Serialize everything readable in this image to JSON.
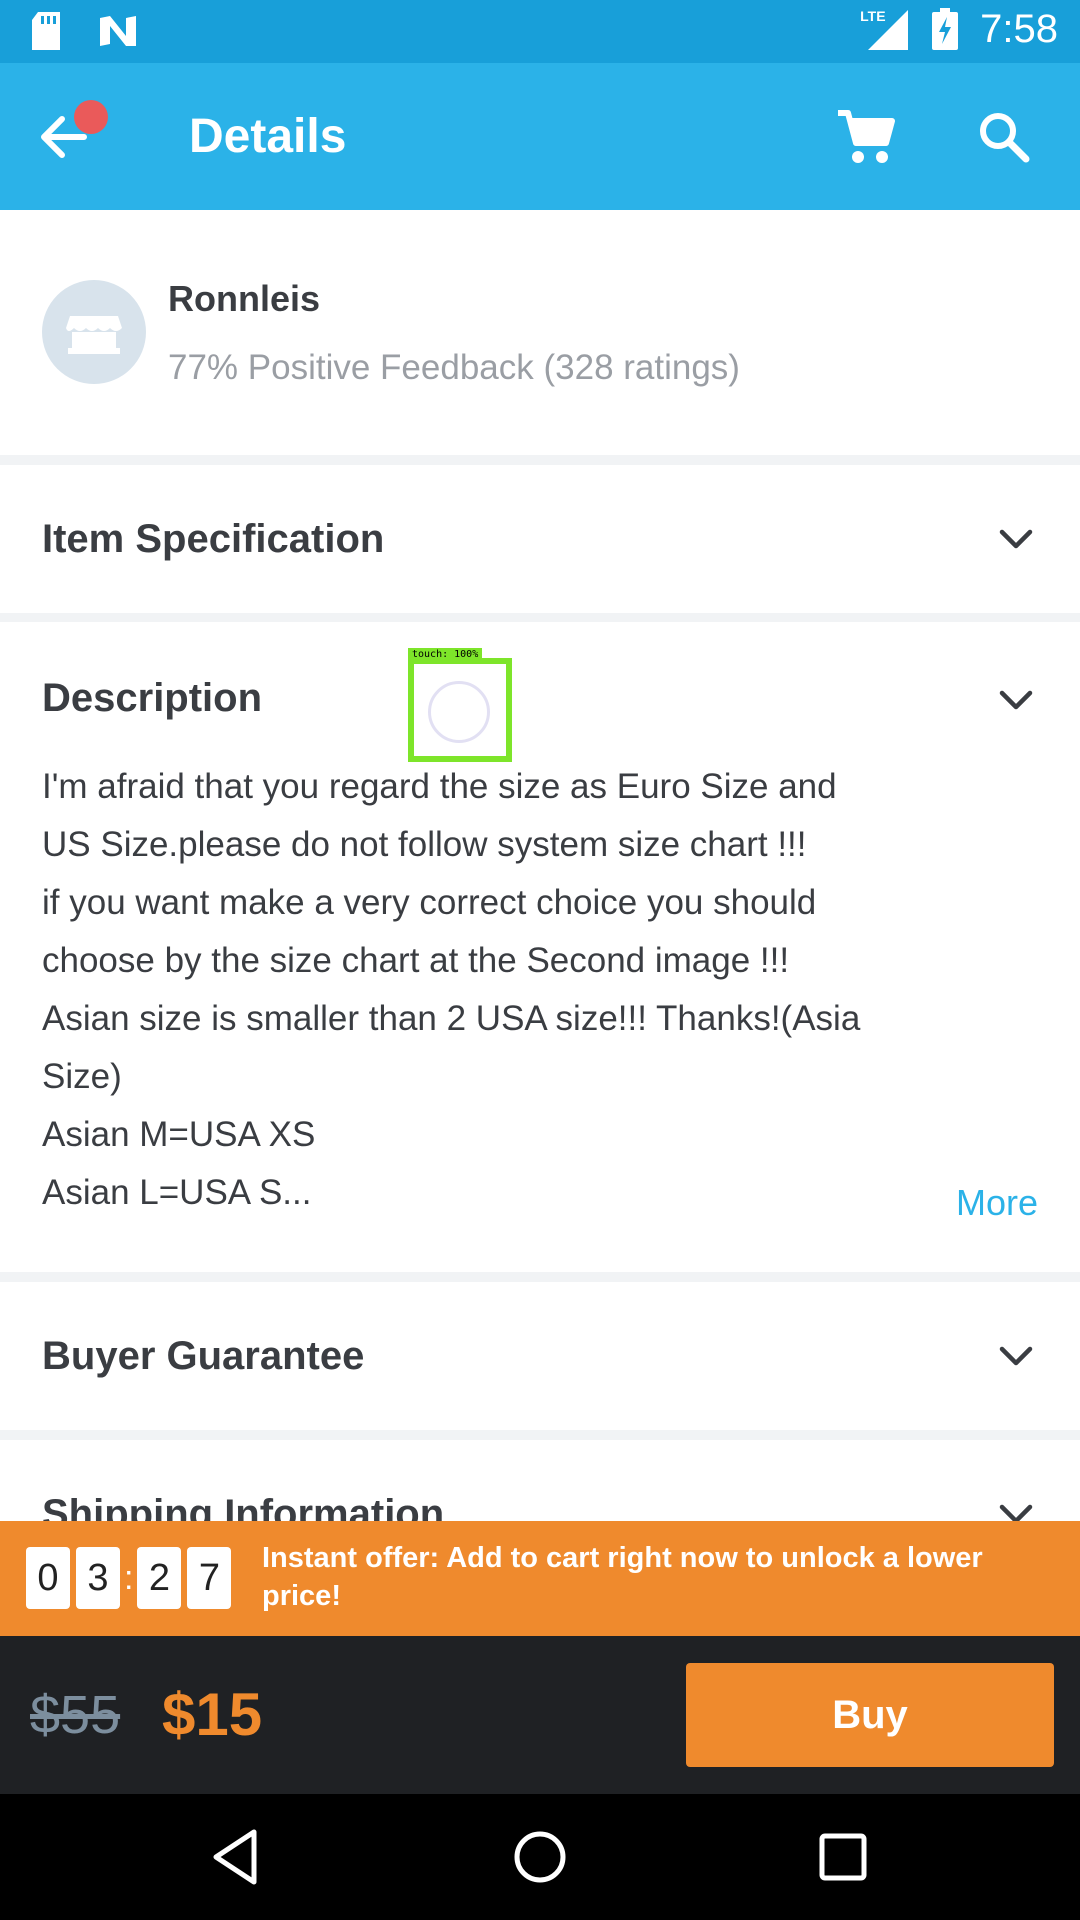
{
  "status_bar": {
    "time": "7:58",
    "network_label": "LTE",
    "icons": [
      "sd-card-icon",
      "n-logo-icon",
      "signal-icon",
      "battery-charging-icon"
    ]
  },
  "app_bar": {
    "title": "Details",
    "icons": [
      "back-arrow-icon",
      "cart-icon",
      "search-icon"
    ]
  },
  "seller": {
    "name": "Ronnleis",
    "feedback": "77% Positive Feedback (328 ratings)"
  },
  "sections": {
    "item_spec": "Item Specification",
    "description": "Description",
    "buyer_guarantee": "Buyer Guarantee",
    "shipping": "Shipping Information"
  },
  "description": {
    "lines": [
      "I'm afraid that you regard the size as Euro Size and",
      "US Size.please do not follow system size chart !!!",
      "if you want make a very correct choice you should",
      "choose by the size chart at the Second image !!!",
      "Asian size is smaller than 2 USA size!!! Thanks!(Asia",
      "Size)",
      "Asian M=USA XS",
      "Asian L=USA S..."
    ],
    "more_label": "More"
  },
  "touch_overlay": {
    "label": "touch: 100%"
  },
  "offer": {
    "timer_digits": [
      "0",
      "3",
      "2",
      "7"
    ],
    "timer_separator": ":",
    "text": "Instant offer: Add to cart right now to unlock a lower price!"
  },
  "buy_bar": {
    "old_price": "$55",
    "new_price": "$15",
    "buy_label": "Buy"
  },
  "colors": {
    "status_bar": "#189fd9",
    "app_bar": "#2bb2e8",
    "accent_orange": "#ef8a2d",
    "link_blue": "#2bb2e8",
    "dark_bar": "#1f2124"
  }
}
